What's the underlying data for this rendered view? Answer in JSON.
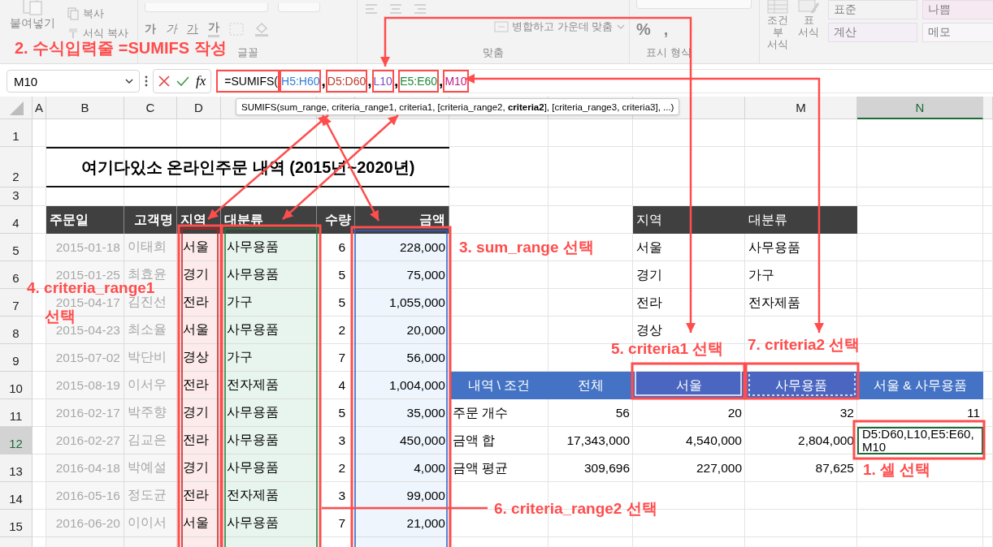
{
  "ribbon": {
    "clipboard": {
      "paste": "붙여넣기",
      "copy": "복사",
      "format_painter": "서식 복사"
    },
    "font": {
      "buttons": [
        {
          "text": "가",
          "kind": "bold"
        },
        {
          "text": "가",
          "kind": "italic"
        },
        {
          "text": "가",
          "kind": "underline"
        },
        {
          "text": "가",
          "kind": "color"
        }
      ],
      "label": "글꼴"
    },
    "alignment": {
      "merge": "병합하고 가운데 맞춤",
      "label": "맞춤"
    },
    "number": {
      "buttons": [
        "%",
        ","
      ],
      "label": "표시 형식"
    },
    "styles": {
      "conditional": "조건부 서식",
      "table": "표 서식",
      "cell_styles": [
        {
          "text": "표준",
          "color": "#f3f3f3"
        },
        {
          "text": "나쁨",
          "color": "#f6e9f1"
        },
        {
          "text": "계산",
          "color": "#f4eef6"
        },
        {
          "text": "메모",
          "color": "#f9f6fa"
        }
      ]
    }
  },
  "formula_bar": {
    "name_box": "M10",
    "fx": "fx",
    "parts": [
      {
        "text": "=SUMIFS(",
        "color": "#000000",
        "boxed": true
      },
      {
        "text": "H5:H60",
        "color": "#2f7ed8",
        "boxed": true
      },
      {
        "text": ",",
        "color": "#000000",
        "boxed": false
      },
      {
        "text": "D5:D60",
        "color": "#c0392b",
        "boxed": true
      },
      {
        "text": ",",
        "color": "#000000",
        "boxed": false
      },
      {
        "text": "L10",
        "color": "#7a4fc0",
        "boxed": true
      },
      {
        "text": ",",
        "color": "#000000",
        "boxed": false
      },
      {
        "text": "E5:E60",
        "color": "#1e8a3a",
        "boxed": true
      },
      {
        "text": ",",
        "color": "#000000",
        "boxed": false
      },
      {
        "text": "M10",
        "color": "#c2188a",
        "boxed": true
      }
    ],
    "tooltip": "SUMIFS(sum_range, criteria_range1, criteria1, [criteria_range2, **criteria2**], [criteria_range3, criteria3], ...)"
  },
  "sheet": {
    "column_headers": [
      {
        "label": "A",
        "selected": false
      },
      {
        "label": "B",
        "selected": false
      },
      {
        "label": "C",
        "selected": false
      },
      {
        "label": "D",
        "selected": false
      },
      {
        "label": "M",
        "selected": false
      },
      {
        "label": "N",
        "selected": true
      }
    ],
    "row_headers": [
      {
        "label": "1",
        "selected": false
      },
      {
        "label": "2",
        "selected": false
      },
      {
        "label": "3",
        "selected": false
      },
      {
        "label": "4",
        "selected": false
      },
      {
        "label": "5",
        "selected": false
      },
      {
        "label": "6",
        "selected": false
      },
      {
        "label": "7",
        "selected": false
      },
      {
        "label": "8",
        "selected": false
      },
      {
        "label": "9",
        "selected": false
      },
      {
        "label": "10",
        "selected": false
      },
      {
        "label": "11",
        "selected": false
      },
      {
        "label": "12",
        "selected": true
      },
      {
        "label": "13",
        "selected": false
      },
      {
        "label": "14",
        "selected": false
      },
      {
        "label": "15",
        "selected": false
      }
    ],
    "title": "여기다있소 온라인주문 내역 (2015년~2020년)",
    "orders": {
      "columns": [
        "주문일",
        "고객명",
        "지역",
        "대분류",
        "수량",
        "금액"
      ],
      "rows": [
        [
          "2015-01-18",
          "이태희",
          "서울",
          "사무용품",
          "6",
          "228,000"
        ],
        [
          "2015-01-25",
          "최효윤",
          "경기",
          "사무용품",
          "5",
          "75,000"
        ],
        [
          "2015-04-17",
          "김진선",
          "전라",
          "가구",
          "5",
          "1,055,000"
        ],
        [
          "2015-04-23",
          "최소율",
          "서울",
          "사무용품",
          "2",
          "20,000"
        ],
        [
          "2015-07-02",
          "박단비",
          "경상",
          "가구",
          "7",
          "56,000"
        ],
        [
          "2015-08-19",
          "이서우",
          "전라",
          "전자제품",
          "4",
          "1,004,000"
        ],
        [
          "2016-02-17",
          "박주향",
          "경기",
          "사무용품",
          "5",
          "35,000"
        ],
        [
          "2016-02-27",
          "김교은",
          "전라",
          "사무용품",
          "3",
          "450,000"
        ],
        [
          "2016-04-18",
          "박예설",
          "경기",
          "사무용품",
          "2",
          "4,000"
        ],
        [
          "2016-05-16",
          "정도균",
          "전라",
          "전자제품",
          "3",
          "99,000"
        ],
        [
          "2016-06-20",
          "이이서",
          "서울",
          "사무용품",
          "7",
          "21,000"
        ]
      ]
    },
    "lookup": {
      "columns": [
        "지역",
        "대분류"
      ],
      "rows": [
        [
          "서울",
          "사무용품"
        ],
        [
          "경기",
          "가구"
        ],
        [
          "전라",
          "전자제품"
        ],
        [
          "경상"
        ]
      ]
    },
    "summary": {
      "columns": [
        "내역 \\ 조건",
        "전체",
        "서울",
        "사무용품",
        "서울 & 사무용품"
      ],
      "rows": [
        {
          "label": "주문 개수",
          "values": [
            "56",
            "20",
            "32",
            "11"
          ]
        },
        {
          "label": "금액 합",
          "values": [
            "17,343,000",
            "4,540,000",
            "2,804,000"
          ],
          "edit_lines": [
            "D5:D60,L10,E5:E60,",
            "M10"
          ]
        },
        {
          "label": "금액 평균",
          "values": [
            "309,696",
            "227,000",
            "87,625"
          ]
        }
      ]
    }
  },
  "annotations": [
    "1. 셀 선택",
    "2. 수식입력줄 =SUMIFS 작성",
    "3. sum_range 선택",
    "4. criteria_range1",
    "선택",
    "5. criteria1 선택",
    "6. criteria_range2 선택",
    "7. criteria2 선택"
  ]
}
